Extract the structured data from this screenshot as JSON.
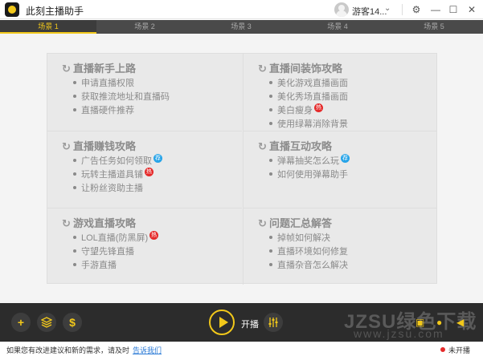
{
  "app": {
    "title": "此刻主播助手"
  },
  "user": {
    "name": "游客14..."
  },
  "window": {
    "settings": "⚙",
    "minimize": "—",
    "maximize": "☐",
    "close": "✕"
  },
  "tabs": [
    "场景 1",
    "场景 2",
    "场景 3",
    "场景 4",
    "场景 5"
  ],
  "active_tab": 0,
  "guide": [
    {
      "title": "直播新手上路",
      "items": [
        {
          "text": "申请直播权限"
        },
        {
          "text": "获取推流地址和直播码"
        },
        {
          "text": "直播硬件推荐"
        }
      ]
    },
    {
      "title": "直播间装饰攻略",
      "items": [
        {
          "text": "美化游戏直播画面"
        },
        {
          "text": "美化秀场直播画面"
        },
        {
          "text": "美白瘦身",
          "badge": "热"
        },
        {
          "text": "使用绿幕消除背景"
        }
      ]
    },
    {
      "title": "直播赚钱攻略",
      "items": [
        {
          "text": "广告任务如何领取",
          "badge": "荐"
        },
        {
          "text": "玩转主播道具铺",
          "badge": "热"
        },
        {
          "text": "让粉丝资助主播"
        }
      ]
    },
    {
      "title": "直播互动攻略",
      "items": [
        {
          "text": "弹幕抽奖怎么玩",
          "badge": "荐"
        },
        {
          "text": "如何使用弹幕助手"
        }
      ]
    },
    {
      "title": "游戏直播攻略",
      "items": [
        {
          "text": "LOL直播(防黑屏)",
          "badge": "热"
        },
        {
          "text": "守望先锋直播"
        },
        {
          "text": "手游直播"
        }
      ]
    },
    {
      "title": "问题汇总解答",
      "items": [
        {
          "text": "掉帧如何解决"
        },
        {
          "text": "直播环境如何修复"
        },
        {
          "text": "直播杂音怎么解决"
        }
      ]
    }
  ],
  "bottom": {
    "add": "+",
    "dollar": "$",
    "start_label": "开播",
    "watermark": "JZSU绿色下载",
    "watermark_url": "www.jzsu.com"
  },
  "status": {
    "feedback_text": "如果您有改进建议和新的需求，请及时",
    "feedback_link": "告诉我们",
    "live_status": "未开播"
  },
  "colors": {
    "accent": "#f2c81a",
    "hot_badge": "#e52a2a",
    "recommend_badge": "#27a4e8"
  }
}
